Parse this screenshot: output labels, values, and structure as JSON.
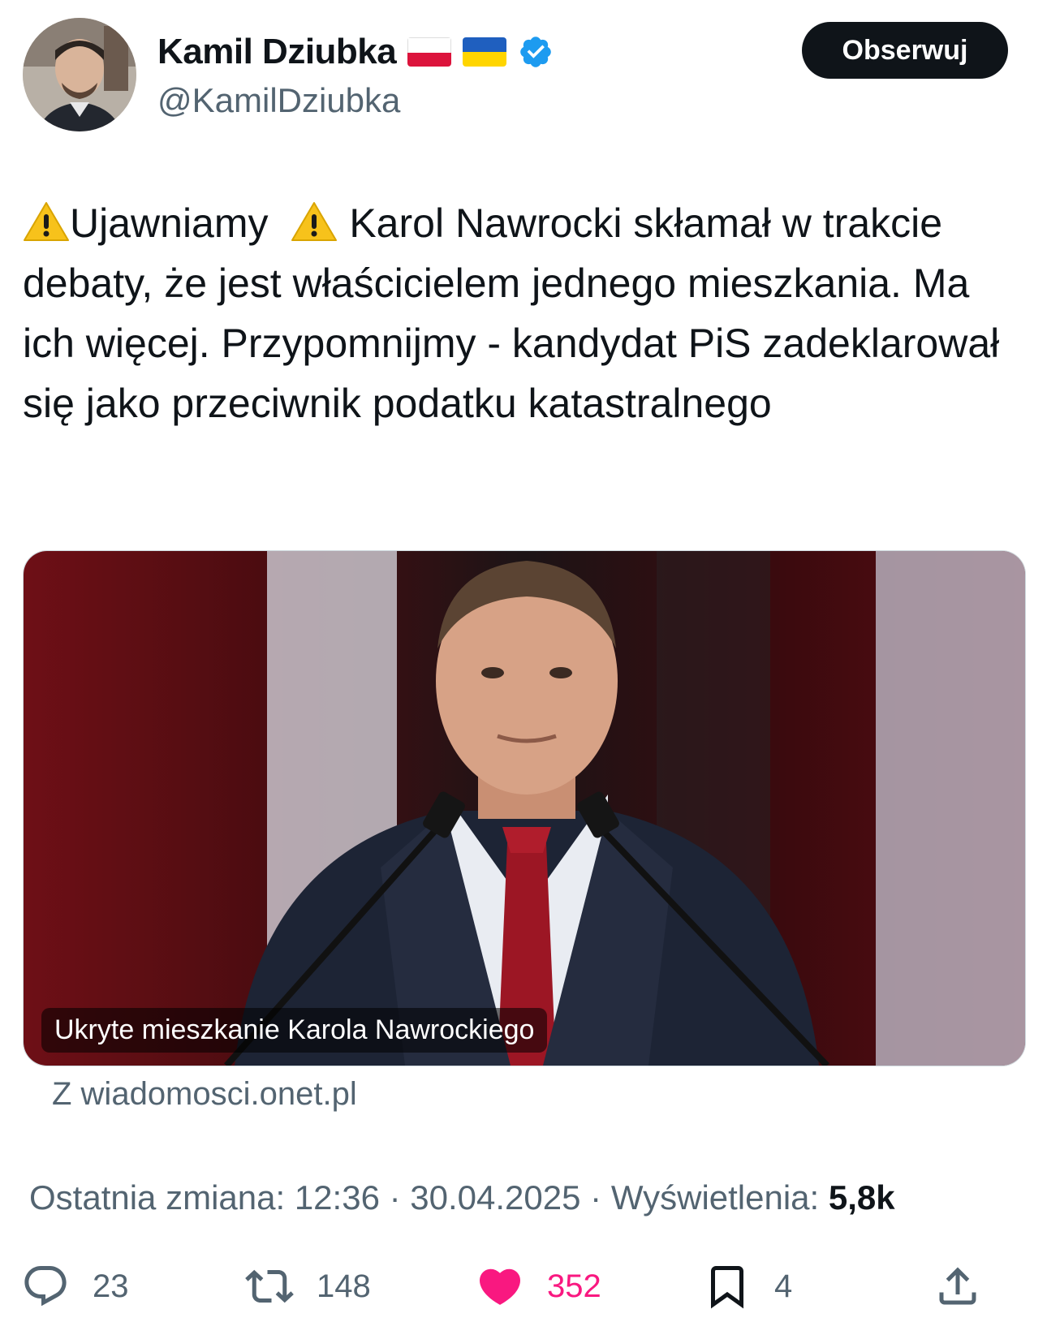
{
  "author": {
    "name": "Kamil Dziubka",
    "handle": "@KamilDziubka",
    "flags": [
      "flag-poland-icon",
      "flag-ukraine-icon"
    ],
    "verified_icon": "verified-badge-icon"
  },
  "follow_button": {
    "label": "Obserwuj"
  },
  "tweet": {
    "warning_icon": "warning-icon",
    "headline": "Ujawniamy",
    "text": "Karol Nawrocki skłamał w trakcie debaty, że jest właścicielem jednego mieszkania. Ma ich więcej. Przypomnijmy - kandydat PiS zadeklarował się jako przeciwnik podatku katastralnego"
  },
  "media": {
    "caption": "Ukryte mieszkanie Karola Nawrockiego",
    "source": "Z wiadomosci.onet.pl"
  },
  "meta": {
    "edited_label": "Ostatnia zmiana:",
    "time": "12:36",
    "separator": "·",
    "date": "30.04.2025",
    "views_label": "Wyświetlenia:",
    "views_count": "5,8k"
  },
  "actions": {
    "replies": "23",
    "reposts": "148",
    "likes": "352",
    "bookmarks": "4"
  },
  "colors": {
    "text_primary": "#0f1419",
    "text_secondary": "#536471",
    "like": "#f91880",
    "verified": "#1d9bf0",
    "button_bg": "#0f1419"
  }
}
